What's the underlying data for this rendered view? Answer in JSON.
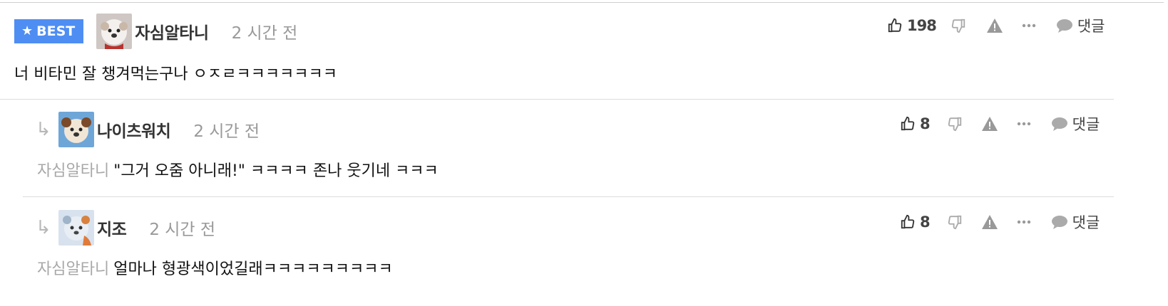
{
  "comments": [
    {
      "badge": "BEST",
      "username": "자심알타니",
      "time": "2 시간 전",
      "mention": "",
      "text": "너 비타민 잘 챙겨먹는구나 ㅇㅈㄹㅋㅋㅋㅋㅋㅋㅋ",
      "likes": "198",
      "reply_label": "댓글"
    },
    {
      "username": "나이츠워치",
      "time": "2 시간 전",
      "mention": "자심알타니",
      "text": "\"그거 오줌 아니래!\" ㅋㅋㅋㅋ 존나 웃기네 ㅋㅋㅋ",
      "likes": "8",
      "reply_label": "댓글"
    },
    {
      "username": "지조",
      "time": "2 시간 전",
      "mention": "자심알타니",
      "text": "얼마나 형광색이었길래ㅋㅋㅋㅋㅋㅋㅋㅋㅋ",
      "likes": "8",
      "reply_label": "댓글"
    }
  ],
  "icons": {
    "best": "star-icon",
    "reply": "reply-arrow-icon",
    "like": "thumbs-up-icon",
    "dislike": "thumbs-down-icon",
    "report": "warning-icon",
    "more": "more-icon",
    "comment": "speech-bubble-icon"
  },
  "colors": {
    "best_badge": "#4e8ef3",
    "meta_gray": "#999999",
    "mention_gray": "#a8a8a8",
    "icon_gray": "#999999"
  }
}
